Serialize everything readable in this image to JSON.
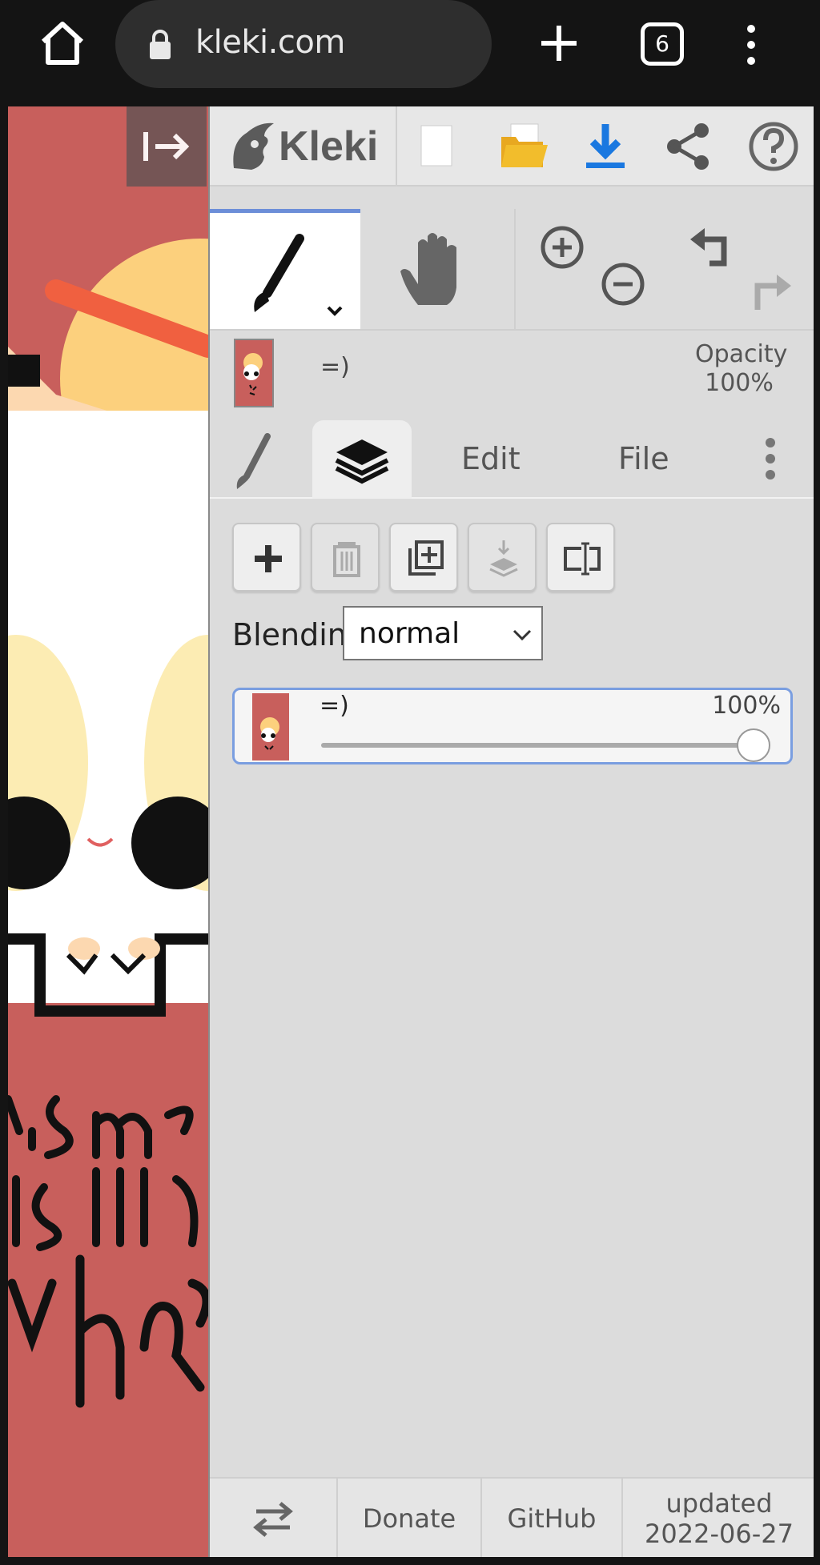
{
  "browser": {
    "url": "kleki.com",
    "tab_count": "6"
  },
  "app": {
    "name": "Kleki"
  },
  "current_layer": {
    "name": "=)",
    "opacity_label": "Opacity",
    "opacity_value": "100%"
  },
  "tabs": {
    "edit": "Edit",
    "file": "File"
  },
  "layers": {
    "blending_label": "Blending",
    "blending_value": "normal",
    "items": [
      {
        "name": "=)",
        "opacity": "100%",
        "opacity_fraction": 1.0
      }
    ]
  },
  "footer": {
    "donate": "Donate",
    "github": "GitHub",
    "updated_line1": "updated",
    "updated_line2": "2022-06-27"
  },
  "colors": {
    "accent_blue": "#6c8ed8",
    "download_blue": "#1a78e0",
    "folder_yellow": "#f2bd2c",
    "canvas_red": "#c85f5c"
  }
}
